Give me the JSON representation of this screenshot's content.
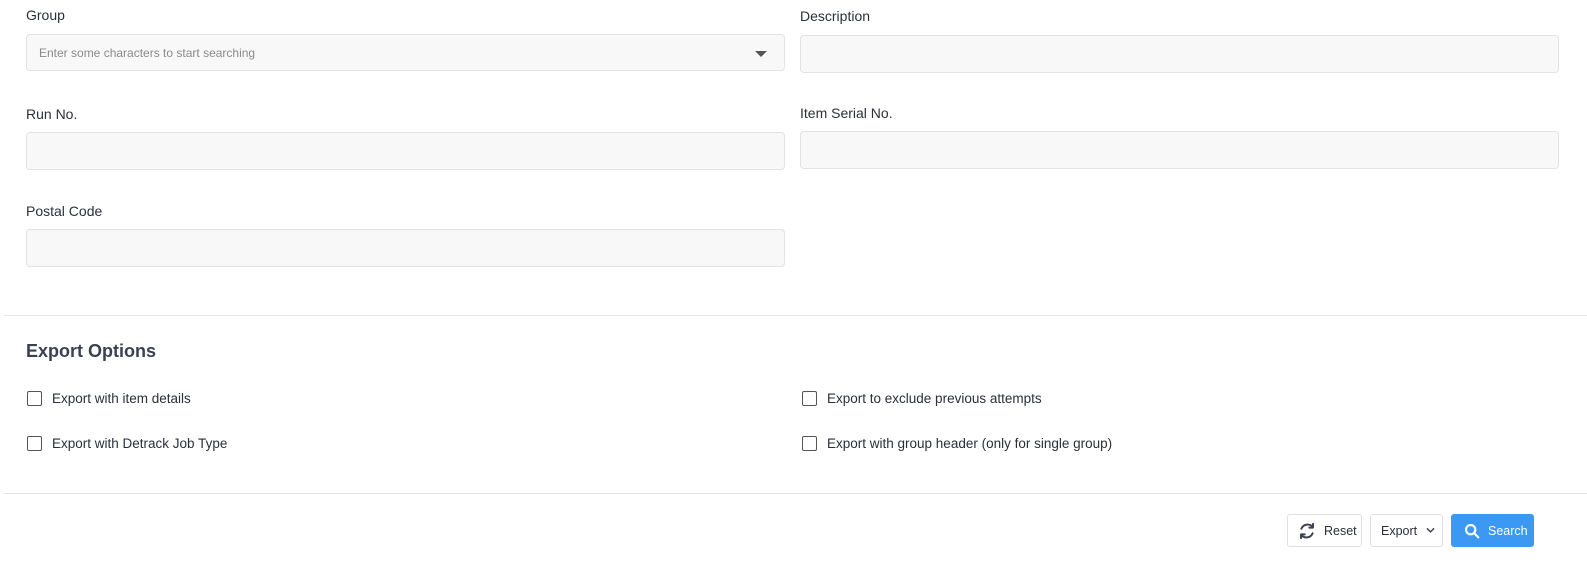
{
  "form": {
    "group": {
      "label": "Group",
      "placeholder": "Enter some characters to start searching"
    },
    "description": {
      "label": "Description",
      "value": ""
    },
    "run_no": {
      "label": "Run No.",
      "value": ""
    },
    "item_serial_no": {
      "label": "Item Serial No.",
      "value": ""
    },
    "postal_code": {
      "label": "Postal Code",
      "value": ""
    }
  },
  "export_options": {
    "title": "Export Options",
    "options": [
      {
        "label": "Export with item details",
        "checked": false
      },
      {
        "label": "Export to exclude previous attempts",
        "checked": false
      },
      {
        "label": "Export with Detrack Job Type",
        "checked": false
      },
      {
        "label": "Export with group header (only for single group)",
        "checked": false
      }
    ]
  },
  "actions": {
    "reset_label": "Reset",
    "export_label": "Export",
    "search_label": "Search"
  },
  "colors": {
    "primary": "#3b99f4",
    "input_bg": "#f8f8f8",
    "border": "#e3e3e3"
  },
  "icons": {
    "reset": "refresh-icon",
    "export": "chevron-down-icon",
    "search": "search-icon",
    "group": "caret-down-icon"
  }
}
